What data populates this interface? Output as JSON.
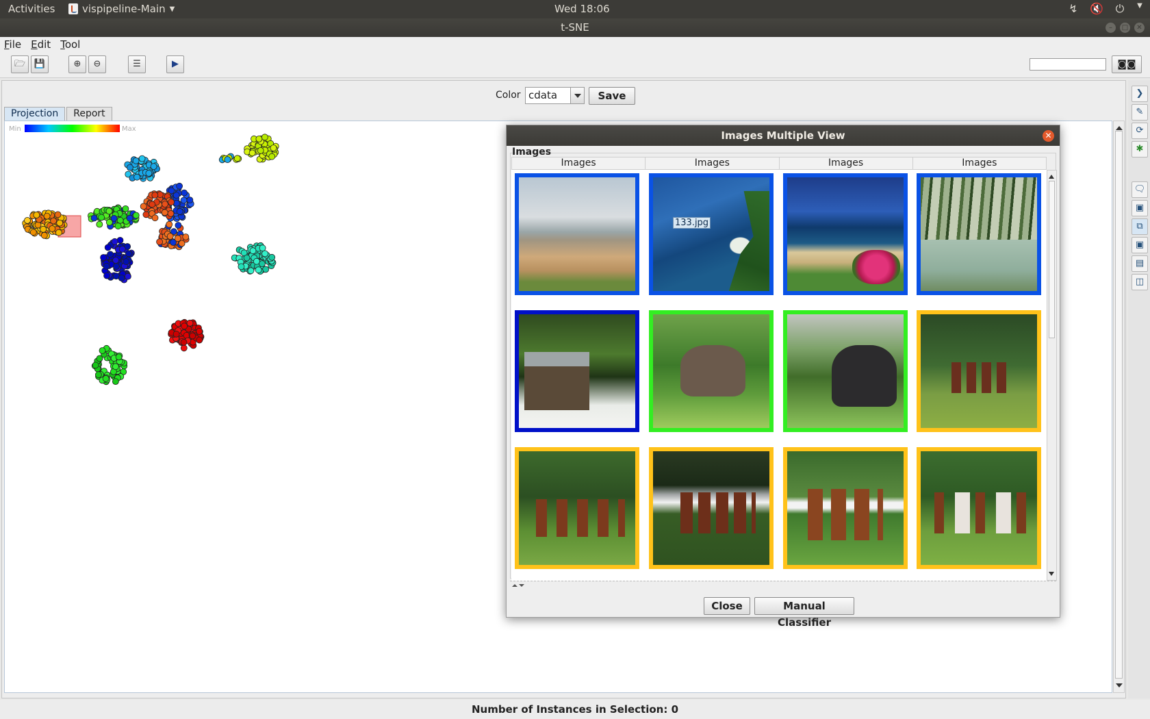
{
  "system_bar": {
    "activities": "Activities",
    "app_name": "vispipeline-Main",
    "clock": "Wed 18:06"
  },
  "window": {
    "title": "t-SNE"
  },
  "menu": {
    "file": "File",
    "edit": "Edit",
    "tool": "Tool"
  },
  "toolbar": {
    "buttons": [
      "open-icon",
      "save-icon",
      "zoom-in-icon",
      "zoom-out-icon",
      "list-icon",
      "play-icon"
    ],
    "search_value": "",
    "search_button_icon": "binoculars-icon"
  },
  "color_bar": {
    "label": "Color",
    "selected": "cdata",
    "save_label": "Save"
  },
  "tabs": [
    {
      "label": "Projection",
      "active": true
    },
    {
      "label": "Report",
      "active": false
    }
  ],
  "legend": {
    "min": "Min",
    "max": "Max"
  },
  "dialog": {
    "title": "Images Multiple View",
    "group_label": "Images",
    "columns": [
      "Images",
      "Images",
      "Images",
      "Images"
    ],
    "tooltip": "133.jpg",
    "images": [
      {
        "scene": "beach",
        "border": "#0a52e6"
      },
      {
        "scene": "bay",
        "border": "#0a52e6"
      },
      {
        "scene": "coast",
        "border": "#0a52e6"
      },
      {
        "scene": "palm-beach",
        "border": "#0a52e6"
      },
      {
        "scene": "hut",
        "border": "#0010c8"
      },
      {
        "scene": "elephant",
        "border": "#33ee22"
      },
      {
        "scene": "elephant",
        "border": "#33ee22"
      },
      {
        "scene": "horses",
        "border": "#ffc21a"
      },
      {
        "scene": "horses",
        "border": "#ffc21a"
      },
      {
        "scene": "horses",
        "border": "#ffc21a"
      },
      {
        "scene": "horses",
        "border": "#ffc21a"
      },
      {
        "scene": "horses",
        "border": "#ffc21a"
      }
    ],
    "close_label": "Close",
    "classifier_label": "Manual Classifier"
  },
  "status": "Number of Instances in Selection: 0",
  "colors": {
    "title_bar": "#3c3b37",
    "tab_active": "#d7e6f4",
    "close_button": "#e45a2c"
  }
}
